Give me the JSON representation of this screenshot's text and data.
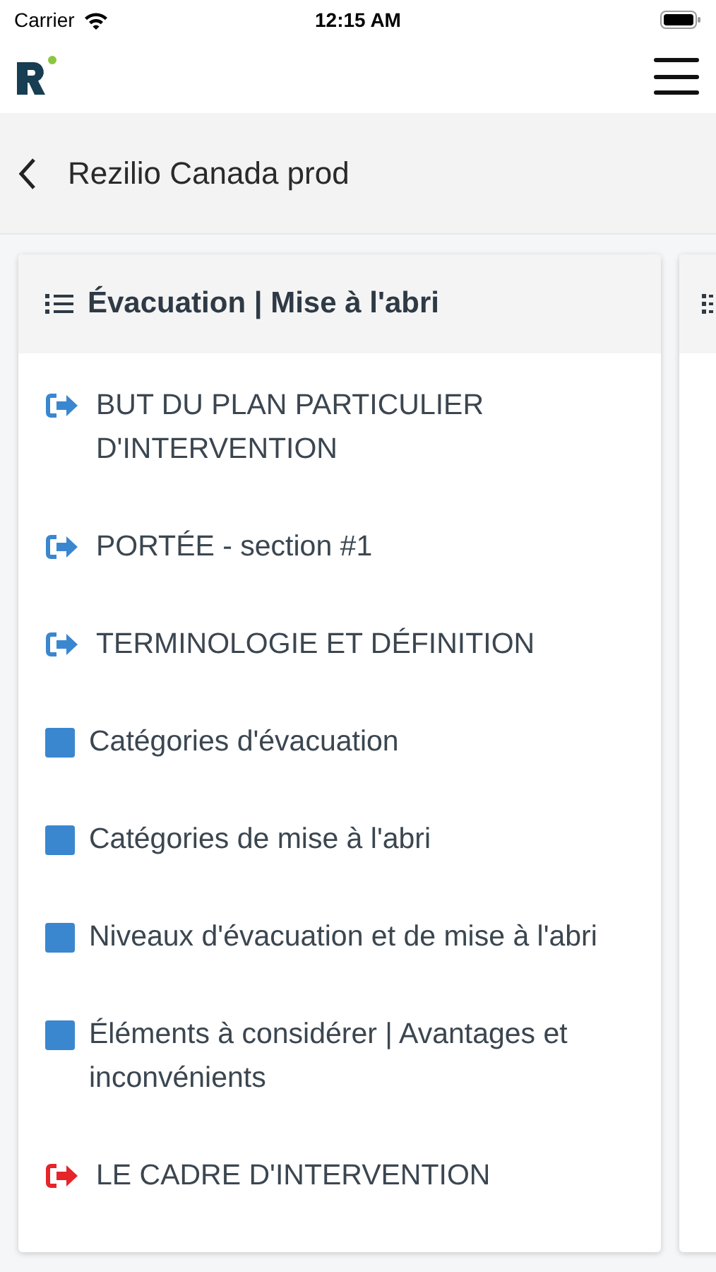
{
  "status_bar": {
    "carrier": "Carrier",
    "time": "12:15 AM"
  },
  "nav": {
    "title": "Rezilio Canada prod"
  },
  "card": {
    "title": "Évacuation | Mise à l'abri",
    "items": [
      {
        "kind": "link",
        "label": "BUT DU PLAN PARTICULIER D'INTERVENTION",
        "color": "#3a87d0"
      },
      {
        "kind": "link",
        "label": "PORTÉE - section #1",
        "color": "#3a87d0"
      },
      {
        "kind": "link",
        "label": "TERMINOLOGIE ET DÉFINITION",
        "color": "#3a87d0"
      },
      {
        "kind": "square",
        "label": "Catégories d'évacuation",
        "color": "#3a87d0"
      },
      {
        "kind": "square",
        "label": "Catégories de mise à l'abri",
        "color": "#3a87d0"
      },
      {
        "kind": "square",
        "label": "Niveaux d'évacuation et de mise à l'abri",
        "color": "#3a87d0"
      },
      {
        "kind": "square",
        "label": "Éléments à considérer | Avantages et inconvénients",
        "color": "#3a87d0"
      },
      {
        "kind": "link",
        "label": "LE CADRE D'INTERVENTION",
        "color": "#e5252a"
      }
    ]
  }
}
